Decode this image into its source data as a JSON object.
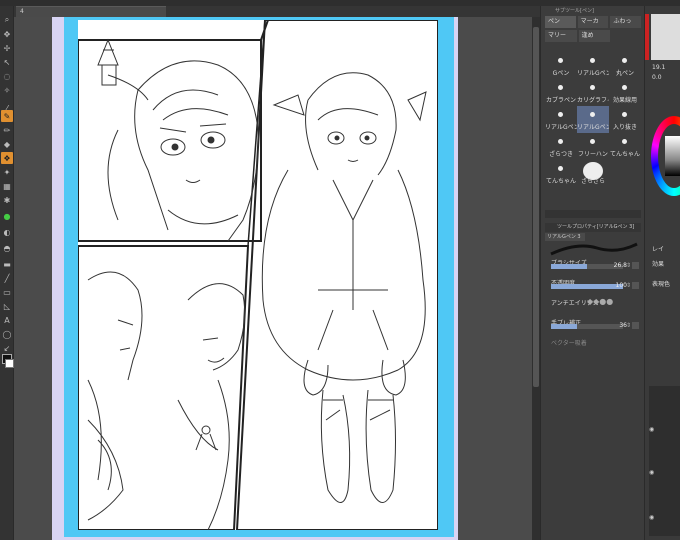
{
  "document": {
    "tab_label": "4"
  },
  "subtool_panel": {
    "title": "サブツール[ペン]",
    "tabs_row1": [
      {
        "label": "ペン",
        "active": true
      },
      {
        "label": "マーカ",
        "active": false
      },
      {
        "label": "ふわっ",
        "active": false
      }
    ],
    "tabs_row2": [
      {
        "label": "マリー",
        "active": false
      },
      {
        "label": "逢め",
        "active": false
      }
    ],
    "brushes": [
      {
        "label": "Gペン",
        "active": false,
        "big": false
      },
      {
        "label": "リアルGペン",
        "active": false,
        "big": false
      },
      {
        "label": "丸ペン",
        "active": false,
        "big": false
      },
      {
        "label": "カブラペン",
        "active": false,
        "big": false
      },
      {
        "label": "カリグラフィ",
        "active": false,
        "big": false
      },
      {
        "label": "効果線用",
        "active": false,
        "big": false
      },
      {
        "label": "リアルGペン",
        "active": false,
        "big": false
      },
      {
        "label": "リアルGペン",
        "active": true,
        "big": false
      },
      {
        "label": "入り抜き",
        "active": false,
        "big": false
      },
      {
        "label": "ざらつき",
        "active": false,
        "big": false
      },
      {
        "label": "フリーハン",
        "active": false,
        "big": false
      },
      {
        "label": "てんちゃん",
        "active": false,
        "big": false
      },
      {
        "label": "てんちゃん",
        "active": false,
        "big": false
      },
      {
        "label": "ざらざら",
        "active": false,
        "big": true
      }
    ]
  },
  "tool_property": {
    "title": "ツールプロパティ[リアルGペン 3]",
    "tab": "リアルGペン 3",
    "brush_size": {
      "label": "ブラシサイズ",
      "value": "26.8",
      "fill": 0.5
    },
    "opacity": {
      "label": "不透明度",
      "value": "100",
      "fill": 1.0
    },
    "antialias": {
      "label": "アンチエイリアス"
    },
    "stabilization": {
      "label": "手ブレ補正",
      "value": "36",
      "fill": 0.36
    },
    "vector": {
      "label": "ベクター吸着"
    }
  },
  "far_panel": {
    "nav_values": [
      "19.1",
      "0.0"
    ],
    "layer_label": "レイ",
    "effect_label": "効果",
    "expression_label": "表現色"
  },
  "colors": {
    "accent": "#e09030",
    "bleed": "#4fc8f5",
    "paper_margin": "#d8d4f4",
    "panel_bg": "#3c3c3c"
  }
}
